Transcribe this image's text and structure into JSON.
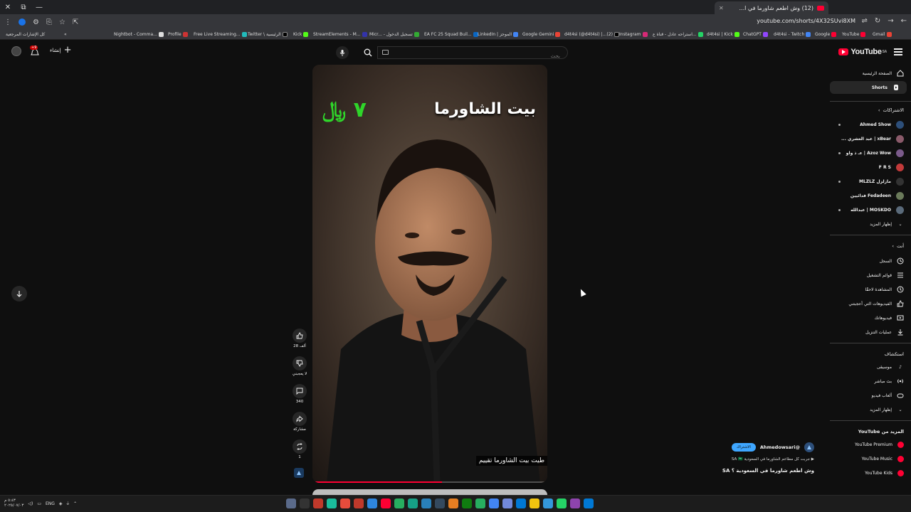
{
  "browser": {
    "tab_title": "(12) وش اطعم شاورما في ا...",
    "url": "youtube.com/shorts/4X32SUvi8XM",
    "bookmarks": [
      "كل الإشارات المرجعية",
      "Nightbot - Comma...",
      "Profile",
      "Free Live Streaming...",
      "Twitter \\ الرئيسية",
      "Kick",
      "StreamElements - M...",
      "Micr... - تسجيل الدخول",
      "EA FC 25 Squad Buil...",
      "LinkedIn | الموجز",
      "Google Gemini",
      "d4t4si (@d4t4si) |...(2)",
      "Instagram",
      "استراحه عادل - قناة ع...",
      "d4t4si | Kick",
      "ChatGPT",
      "d4t4si - Twitch",
      "Google",
      "YouTube",
      "Gmail"
    ]
  },
  "header": {
    "logo_text": "YouTube",
    "region": "SA",
    "search_placeholder": "بحث",
    "create_label": "إنشاء",
    "notif_count": "+9"
  },
  "sidebar": {
    "main": [
      {
        "label": "الصفحة الرئيسية",
        "icon": "home-icon"
      },
      {
        "label": "Shorts",
        "icon": "shorts-icon",
        "active": true
      }
    ],
    "subscriptions_title": "الاشتراكات",
    "subscriptions": [
      {
        "label": "Ahmed Show",
        "color": "#2d4f7a",
        "live": true
      },
      {
        "label": "xBear | عبد العشري ...",
        "color": "#8a5a6a",
        "live": true
      },
      {
        "label": "Azoz Wow | عـ ذ واو",
        "color": "#7a5a8a",
        "live": true
      },
      {
        "label": "F R S",
        "color": "#c23a3a",
        "live": false
      },
      {
        "label": "مازلزل MLZLZ",
        "color": "#333333",
        "live": true
      },
      {
        "label": "Fedadeen فدائيين",
        "color": "#6a7a5a",
        "live": false
      },
      {
        "label": "MOSKDO | عبدالله",
        "color": "#5a6a7a",
        "live": true
      }
    ],
    "show_more_1": "إظهار المزيد",
    "you_title": "أنت",
    "you_items": [
      {
        "label": "السجل",
        "icon": "history-icon"
      },
      {
        "label": "قوائم التشغيل",
        "icon": "playlist-icon"
      },
      {
        "label": "المشاهدة لاحقًا",
        "icon": "watch-later-icon"
      },
      {
        "label": "الفيديوهات التي أعجبتني",
        "icon": "like-icon"
      },
      {
        "label": "فيديوهاتك",
        "icon": "your-videos-icon"
      },
      {
        "label": "عمليات التنزيل",
        "icon": "download-icon"
      }
    ],
    "explore_title": "استكشاف",
    "explore_items": [
      {
        "label": "موسيقى",
        "icon": "music-icon"
      },
      {
        "label": "بث مباشر",
        "icon": "live-icon"
      },
      {
        "label": "ألعاب فيديو",
        "icon": "gaming-icon"
      }
    ],
    "show_more_2": "إظهار المزيد",
    "more_title": "المزيد من YouTube",
    "more_items": [
      {
        "label": "YouTube Premium"
      },
      {
        "label": "YouTube Music"
      },
      {
        "label": "YouTube Kids"
      }
    ]
  },
  "short": {
    "overlay_title": "بيت الشاورما",
    "overlay_price": "٧ ﷼",
    "subtitle": "طيت بيت الشاورما تقييم",
    "progress": 0.55,
    "channel_handle": "@Ahmedowsari",
    "subscribe_label": "الاشتراك",
    "description": "جربت كل مطاعم الشاورما في السعودية SA 🇸🇦",
    "title": "وش اطعم  شاورما في السعودية ؟ SA"
  },
  "actions": {
    "likes": "28 ألف",
    "dislike": "لا يعجبني",
    "comments": "340",
    "share": "مشاركة",
    "remix": "1"
  },
  "taskbar": {
    "lang": "ENG",
    "time": "٥:٤٣ م",
    "date": "٢٠٢٥/٠٧/٠٣"
  }
}
